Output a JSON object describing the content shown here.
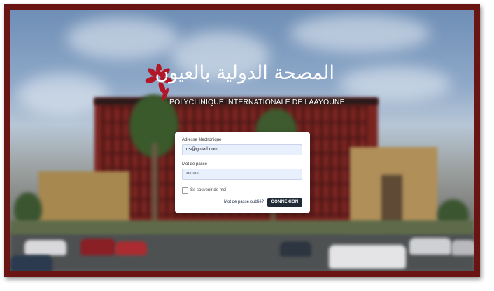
{
  "brand": {
    "arabic_name": "المصحة الدولية بالعيون",
    "latin_name": "POLYCLINIQUE INTERNATIONALE DE LAAYOUNE",
    "logo_color": "#b0182a"
  },
  "login": {
    "email_label": "Adresse électronique",
    "email_value": "cs@gmail.com",
    "password_label": "Mot de passe",
    "password_value": "••••••••",
    "remember_label": "Se souvenir de moi",
    "forgot_link": "Mot de passe oublié?",
    "submit_label": "CONNEXION"
  },
  "colors": {
    "frame": "#6a1414",
    "button": "#1f2a36",
    "input_bg": "#e8effd"
  }
}
